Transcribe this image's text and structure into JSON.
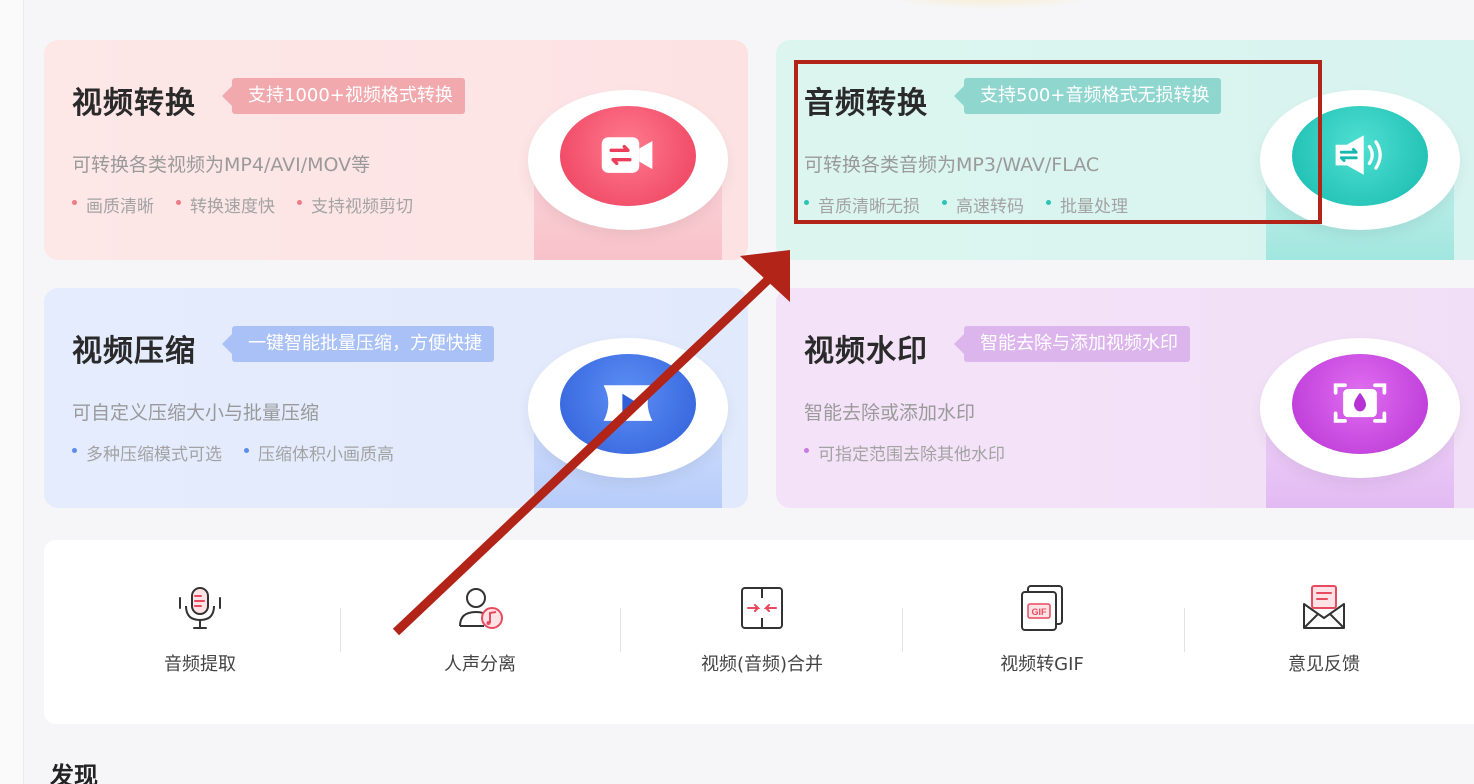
{
  "cards": [
    {
      "title": "视频转换",
      "tag": "支持1000+视频格式转换",
      "desc": "可转换各类视频为MP4/AVI/MOV等",
      "features": [
        "画质清晰",
        "转换速度快",
        "支持视频剪切"
      ],
      "icon": "video-convert-icon"
    },
    {
      "title": "音频转换",
      "tag": "支持500+音频格式无损转换",
      "desc": "可转换各类音频为MP3/WAV/FLAC",
      "features": [
        "音质清晰无损",
        "高速转码",
        "批量处理"
      ],
      "icon": "audio-convert-icon"
    },
    {
      "title": "视频压缩",
      "tag": "一键智能批量压缩，方便快捷",
      "desc": "可自定义压缩大小与批量压缩",
      "features": [
        "多种压缩模式可选",
        "压缩体积小画质高"
      ],
      "icon": "video-compress-icon"
    },
    {
      "title": "视频水印",
      "tag": "智能去除与添加视频水印",
      "desc": "智能去除或添加水印",
      "features": [
        "可指定范围去除其他水印"
      ],
      "icon": "watermark-icon"
    }
  ],
  "tools": [
    {
      "label": "音频提取",
      "icon": "microphone-icon"
    },
    {
      "label": "人声分离",
      "icon": "voice-separate-icon"
    },
    {
      "label": "视频(音频)合并",
      "icon": "merge-icon"
    },
    {
      "label": "视频转GIF",
      "icon": "gif-icon"
    },
    {
      "label": "意见反馈",
      "icon": "feedback-mail-icon"
    }
  ],
  "section": {
    "title": "发现"
  },
  "colors": {
    "annotation_red": "#b22418",
    "video_convert": "#ec3d5b",
    "audio_convert": "#16b9ae",
    "video_compress": "#2f5ed8",
    "watermark": "#b732d4"
  }
}
